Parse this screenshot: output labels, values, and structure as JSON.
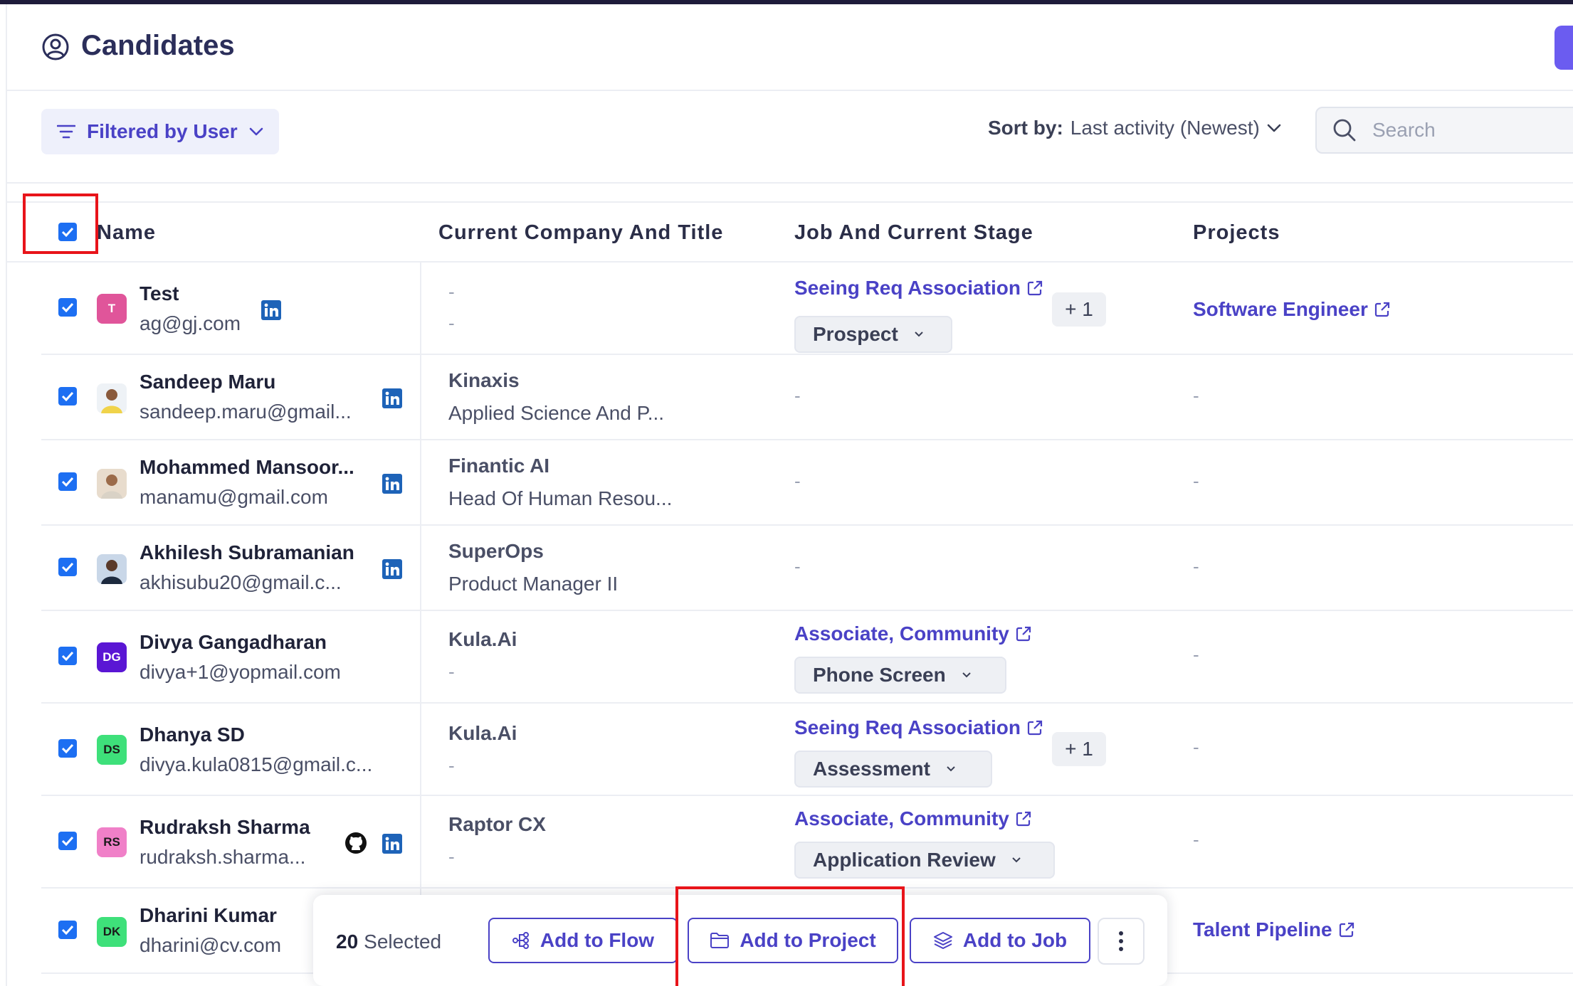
{
  "header": {
    "title": "Candidates",
    "icon": "user-circle-icon"
  },
  "toolbar": {
    "filter_label": "Filtered by User",
    "sort_prefix": "Sort by:",
    "sort_value": "Last activity (Newest)",
    "search_placeholder": "Search"
  },
  "table": {
    "columns": [
      "Name",
      "Current Company And Title",
      "Job And Current Stage",
      "Projects"
    ],
    "rows": [
      {
        "initials": "T",
        "avatar_color": "#e0559a",
        "name": "Test",
        "email": "ag@gj.com",
        "company": "-",
        "title": "-",
        "job": "Seeing Req Association",
        "stage": "Prospect",
        "extra": "+ 1",
        "project": "Software Engineer"
      },
      {
        "initials": "",
        "avatar_color": "#f0d34a",
        "name": "Sandeep Maru",
        "email": "sandeep.maru@gmail...",
        "company": "Kinaxis",
        "title": "Applied Science And P...",
        "job": "-",
        "stage": "",
        "extra": "",
        "project": "-"
      },
      {
        "initials": "",
        "avatar_color": "#c8a88a",
        "name": "Mohammed Mansoor...",
        "email": "manamu@gmail.com",
        "company": "Finantic AI",
        "title": "Head Of Human Resou...",
        "job": "-",
        "stage": "",
        "extra": "",
        "project": "-"
      },
      {
        "initials": "",
        "avatar_color": "#3b5a80",
        "name": "Akhilesh Subramanian",
        "email": "akhisubu20@gmail.c...",
        "company": "SuperOps",
        "title": "Product Manager II",
        "job": "-",
        "stage": "",
        "extra": "",
        "project": "-"
      },
      {
        "initials": "DG",
        "avatar_color": "#5a16d4",
        "name": "Divya Gangadharan",
        "email": "divya+1@yopmail.com",
        "company": "Kula.Ai",
        "title": "-",
        "job": "Associate, Community",
        "stage": "Phone Screen",
        "extra": "",
        "project": "-"
      },
      {
        "initials": "DS",
        "avatar_color": "#3ee07a",
        "name": "Dhanya SD",
        "email": "divya.kula0815@gmail.c...",
        "company": "Kula.Ai",
        "title": "-",
        "job": "Seeing Req Association",
        "stage": "Assessment",
        "extra": "+ 1",
        "project": "-"
      },
      {
        "initials": "RS",
        "avatar_color": "#f080c8",
        "name": "Rudraksh Sharma",
        "email": "rudraksh.sharma...",
        "company": "Raptor CX",
        "title": "-",
        "job": "Associate, Community",
        "stage": "Application Review",
        "extra": "",
        "project": "-"
      },
      {
        "initials": "DK",
        "avatar_color": "#3ee07a",
        "name": "Dharini Kumar",
        "email": "dharini@cv.com",
        "company": "",
        "title": "",
        "job": "",
        "stage": "",
        "extra": "",
        "project": "Talent Pipeline"
      }
    ]
  },
  "bulk_bar": {
    "count": "20",
    "count_label": "Selected",
    "add_to_flow": "Add to Flow",
    "add_to_project": "Add to Project",
    "add_to_job": "Add to Job"
  },
  "colors": {
    "accent": "#4a42c6",
    "checkbox": "#1d6ff2",
    "highlight": "#e8141a"
  }
}
